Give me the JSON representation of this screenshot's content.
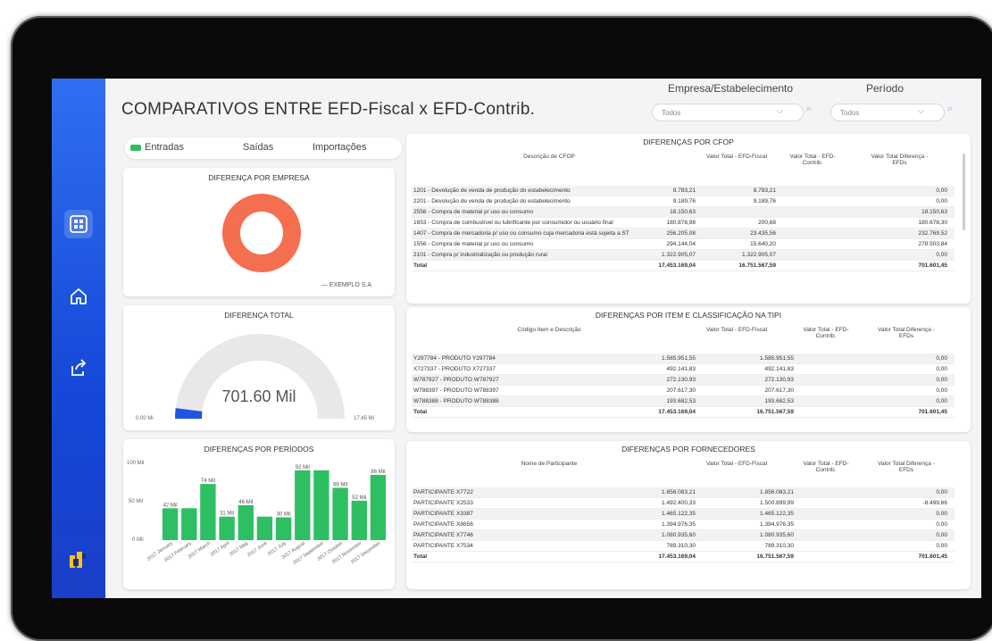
{
  "title": "COMPARATIVOS ENTRE EFD-Fiscal x EFD-Contrib.",
  "filters": {
    "empresa_label": "Empresa/Estabelecimento",
    "empresa_value": "Todos",
    "periodo_label": "Período",
    "periodo_value": "Todos"
  },
  "tabs": [
    "Entradas",
    "Saídas",
    "Importações"
  ],
  "empresa_card": {
    "title": "DIFERENÇA POR EMPRESA",
    "legend": "EXEMPLO S.A",
    "color": "#f46f4f"
  },
  "total_card": {
    "title": "DIFERENÇA TOTAL",
    "value": "701.60 Mil",
    "min_label": "0.00 Mi",
    "max_label": "17.45 Mi",
    "fill_fraction": 0.04
  },
  "periodos_card": {
    "title": "DIFERENÇAS POR PERÍODOS",
    "y_ticks": [
      "100 Mil",
      "50 Mil",
      "0 Mil"
    ],
    "bar_color": "#2fbf63"
  },
  "chart_data": {
    "type": "bar",
    "categories": [
      "2017 January",
      "2017 February",
      "2017 March",
      "2017 April",
      "2017 May",
      "2017 June",
      "2017 July",
      "2017 August",
      "2017 September",
      "2017 October",
      "2017 November",
      "2017 December"
    ],
    "values": [
      42,
      42,
      74,
      31,
      46,
      31,
      30,
      92,
      92,
      69,
      52,
      86
    ],
    "labels": [
      "42 Mil",
      "",
      "74 Mil",
      "31 Mil",
      "46 Mil",
      "",
      "30 Mil",
      "92 Mil",
      "",
      "69 Mil",
      "52 Mil",
      "86 Mil"
    ],
    "ylim": [
      0,
      100
    ],
    "ylabel": "",
    "xlabel": ""
  },
  "cfop": {
    "title": "DIFERENÇAS POR CFOP",
    "headers": [
      "Descrição de CFOP",
      "Valor Total - EFD-Fiscal",
      "Valor Total - EFD-Contrib.",
      "Valor Total Diferença - EFDs"
    ],
    "rows": [
      [
        "1201 - Devolução de venda de produção do estabelecimento",
        "8.783,21",
        "8.783,21",
        "0,00"
      ],
      [
        "2201 - Devolução de venda de produção do estabelecimento",
        "9.189,76",
        "9.189,76",
        "0,00"
      ],
      [
        "2556 - Compra de material p/ uso ou consumo",
        "18.150,63",
        "",
        "18.150,63"
      ],
      [
        "1653 - Compra de combustível ou lubrificante por consumidor ou usuário final",
        "180.878,98",
        "200,68",
        "180.678,30"
      ],
      [
        "1407 - Compra de mercadoria p/ uso ou consumo cuja mercadoria está sujeita a ST",
        "256.205,08",
        "23.435,56",
        "232.769,52"
      ],
      [
        "1556 - Compra de material p/ uso ou consumo",
        "294.144,04",
        "15.640,20",
        "278.503,84"
      ],
      [
        "2101 - Compra p/ industrialização ou produção rural",
        "1.322.905,07",
        "1.322.905,07",
        "0,00"
      ]
    ],
    "total": [
      "Total",
      "17.453.169,04",
      "16.751.567,59",
      "701.601,45"
    ]
  },
  "tipi": {
    "title": "DIFERENÇAS POR ITEM E CLASSIFICAÇÃO NA TIPI",
    "headers": [
      "Código Item e Descrição",
      "Valor Total - EFD-Fiscal",
      "Valor Total - EFD-Contrib.",
      "Valor Total Diferença - EFDs"
    ],
    "rows": [
      [
        "Y297784 - PRODUTO Y297784",
        "1.585.951,55",
        "1.585.951,55",
        "0,00"
      ],
      [
        "X727337 - PRODUTO X727337",
        "492.141,83",
        "492.141,83",
        "0,00"
      ],
      [
        "W787927 - PRODUTO W787927",
        "272.130,93",
        "272.130,93",
        "0,00"
      ],
      [
        "W788397 - PRODUTO W788397",
        "207.617,30",
        "207.617,30",
        "0,00"
      ],
      [
        "W788388 - PRODUTO W788388",
        "193.682,53",
        "193.682,53",
        "0,00"
      ]
    ],
    "total": [
      "Total",
      "17.453.169,04",
      "16.751.567,59",
      "701.601,45"
    ]
  },
  "fornecedores": {
    "title": "DIFERENÇAS POR FORNECEDORES",
    "headers": [
      "Nome de Participante",
      "Valor Total - EFD-Fiscal",
      "Valor Total - EFD-Contrib.",
      "Valor Total Diferença - EFDs"
    ],
    "rows": [
      [
        "PARTICIPANTE X7722",
        "1.856.083,21",
        "1.856.083,21",
        "0,00"
      ],
      [
        "PARTICIPANTE X2533",
        "1.492.400,33",
        "1.500.899,99",
        "-8.499,66"
      ],
      [
        "PARTICIPANTE X3387",
        "1.465.122,35",
        "1.465.122,35",
        "0,00"
      ],
      [
        "PARTICIPANTE X8656",
        "1.394.976,35",
        "1.394.976,35",
        "0,00"
      ],
      [
        "PARTICIPANTE X7746",
        "1.080.935,60",
        "1.080.935,60",
        "0,00"
      ],
      [
        "PARTICIPANTE X7534",
        "789.310,30",
        "789.310,30",
        "0,00"
      ]
    ],
    "total": [
      "Total",
      "17.453.169,04",
      "16.751.567,59",
      "701.601,45"
    ]
  },
  "colors": {
    "sidebar": "#1f55e0",
    "accent": "#2fbf63",
    "donut": "#f46f4f",
    "gauge_fill": "#1f55e0"
  }
}
